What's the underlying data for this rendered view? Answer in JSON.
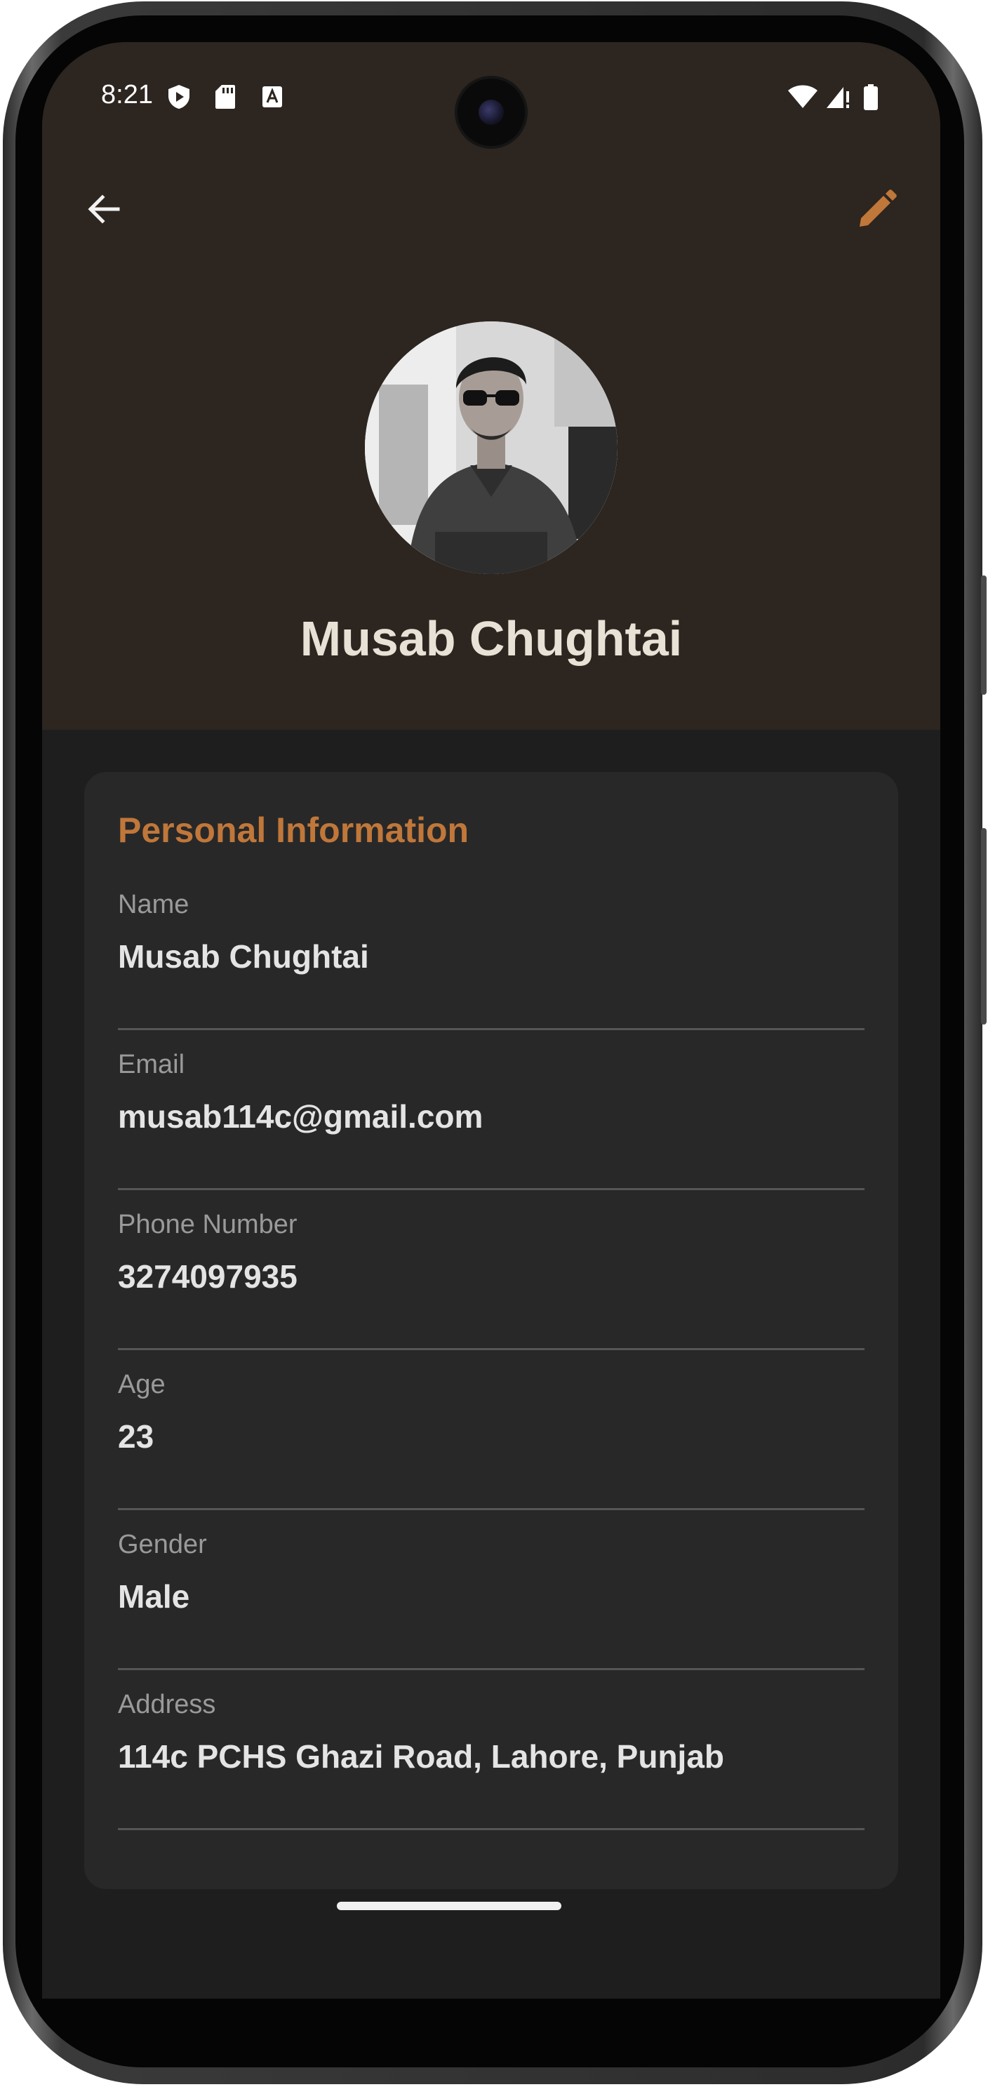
{
  "status_bar": {
    "time": "8:21",
    "left_icons": [
      "play-protect-icon",
      "sd-card-icon",
      "font-icon"
    ],
    "right_icons": [
      "wifi-icon",
      "signal-icon",
      "battery-icon"
    ]
  },
  "app_bar": {
    "back_icon": "arrow-back-icon",
    "edit_icon": "pencil-icon"
  },
  "profile": {
    "name": "Musab Chughtai"
  },
  "personal_info": {
    "title": "Personal Information",
    "fields": [
      {
        "label": "Name",
        "value": "Musab Chughtai"
      },
      {
        "label": "Email",
        "value": "musab114c@gmail.com"
      },
      {
        "label": "Phone Number",
        "value": "3274097935"
      },
      {
        "label": "Age",
        "value": "23"
      },
      {
        "label": "Gender",
        "value": "Male"
      },
      {
        "label": "Address",
        "value": "114c PCHS Ghazi Road, Lahore, Punjab"
      }
    ]
  },
  "colors": {
    "header_bg": "#2d2520",
    "screen_bg": "#1e1e1e",
    "card_bg": "#282828",
    "accent": "#c0773a",
    "name_text": "#e8e2d6"
  }
}
